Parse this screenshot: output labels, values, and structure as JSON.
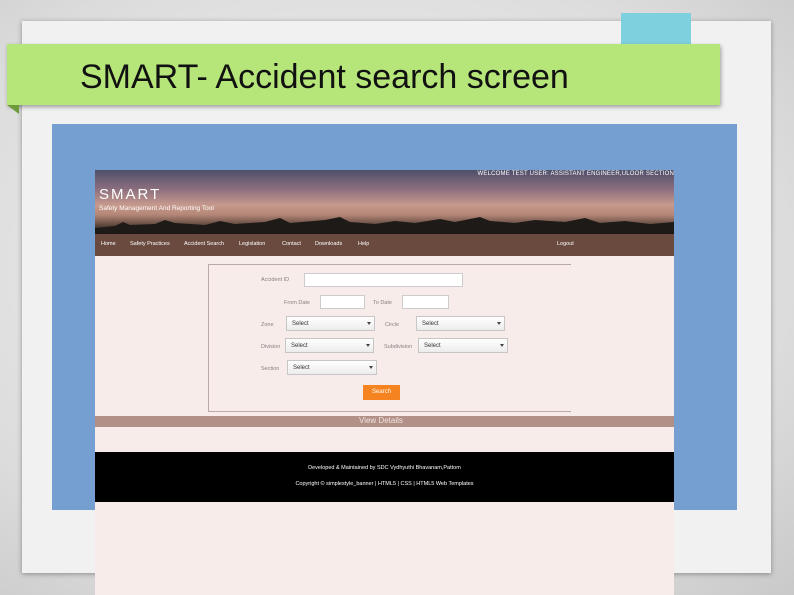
{
  "slide": {
    "title": "SMART- Accident search screen"
  },
  "app": {
    "welcome": "WELCOME TEST USER: ASSISTANT ENGINEER,ULOOR SECTION",
    "logo": "SMART",
    "tagline": "Safety Management And Reporting Tool",
    "nav": {
      "home": "Home",
      "safety_practices": "Safety Practices",
      "accident_search": "Accident Search",
      "legislation": "Legislation",
      "contact": "Contact",
      "downloads": "Downloads",
      "help": "Help",
      "logout": "Logout"
    },
    "form": {
      "accident_id_label": "Accident ID",
      "accident_id_value": "",
      "from_date_label": "From Date",
      "from_date_value": "",
      "to_date_label": "To Date",
      "to_date_value": "",
      "zone_label": "Zone",
      "zone_value": "Select",
      "circle_label": "Circle",
      "circle_value": "Select",
      "division_label": "Division",
      "division_value": "Select",
      "subdivision_label": "Subdivision",
      "subdivision_value": "Select",
      "section_label": "Section",
      "section_value": "Select",
      "search_button": "Search"
    },
    "view_details": "View Details",
    "footer": {
      "line1": "Developed & Maintained by SDC Vydhyuthi Bhavanam,Pattom",
      "line2": "Copyright © simplestyle_banner | HTML5 | CSS | HTML5 Web Templates"
    }
  }
}
